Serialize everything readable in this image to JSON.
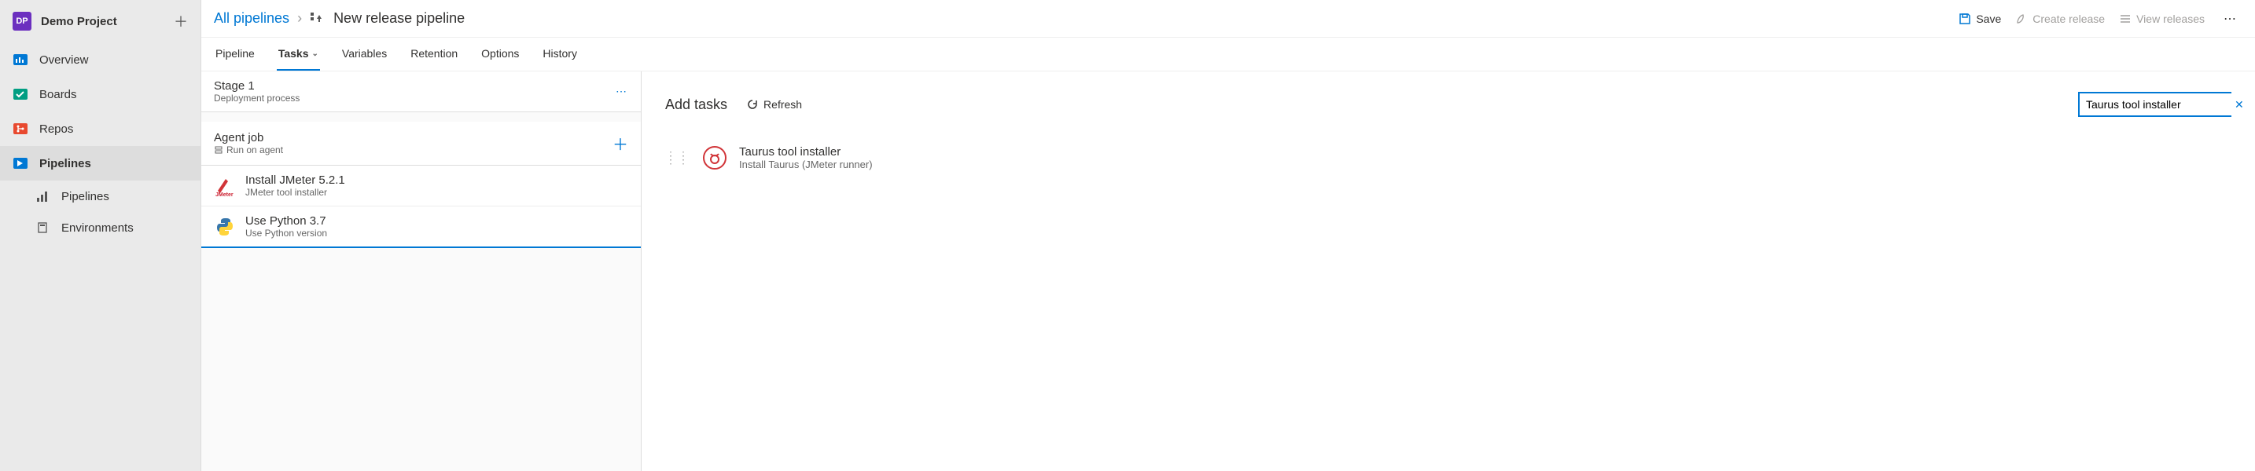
{
  "project": {
    "badge": "DP",
    "name": "Demo Project"
  },
  "sidebar": {
    "items": [
      {
        "label": "Overview"
      },
      {
        "label": "Boards"
      },
      {
        "label": "Repos"
      },
      {
        "label": "Pipelines"
      }
    ],
    "subitems": [
      {
        "label": "Pipelines"
      },
      {
        "label": "Environments"
      }
    ]
  },
  "breadcrumb": {
    "root": "All pipelines",
    "current": "New release pipeline"
  },
  "toolbar": {
    "save": "Save",
    "create_release": "Create release",
    "view_releases": "View releases"
  },
  "tabs": [
    {
      "label": "Pipeline"
    },
    {
      "label": "Tasks"
    },
    {
      "label": "Variables"
    },
    {
      "label": "Retention"
    },
    {
      "label": "Options"
    },
    {
      "label": "History"
    }
  ],
  "stage": {
    "title": "Stage 1",
    "subtitle": "Deployment process"
  },
  "job": {
    "title": "Agent job",
    "subtitle": "Run on agent"
  },
  "tasks": [
    {
      "title": "Install JMeter 5.2.1",
      "subtitle": "JMeter tool installer"
    },
    {
      "title": "Use Python 3.7",
      "subtitle": "Use Python version"
    }
  ],
  "details": {
    "title": "Add tasks",
    "refresh": "Refresh",
    "search_value": "Taurus tool installer"
  },
  "results": [
    {
      "title": "Taurus tool installer",
      "subtitle": "Install Taurus (JMeter runner)"
    }
  ]
}
